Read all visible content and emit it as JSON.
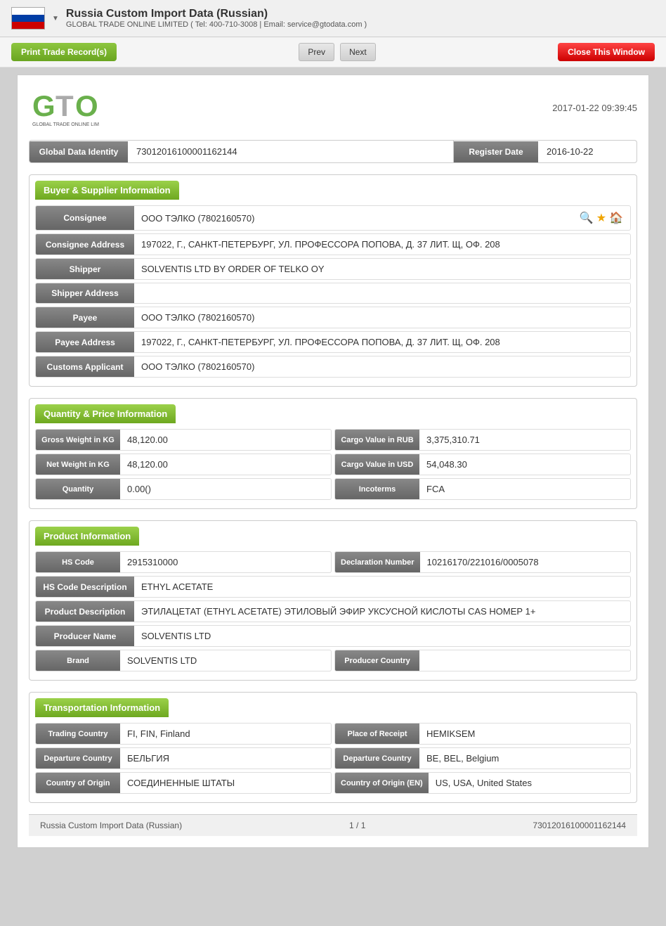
{
  "header": {
    "title": "Russia Custom Import Data (Russian)",
    "company": "GLOBAL TRADE ONLINE LIMITED ( Tel: 400-710-3008 | Email: service@gtodata.com )",
    "dropdown_arrow": "▼"
  },
  "toolbar": {
    "print_label": "Print Trade Record(s)",
    "prev_label": "Prev",
    "next_label": "Next",
    "close_label": "Close This Window"
  },
  "record": {
    "datetime": "2017-01-22 09:39:45",
    "global_data_identity_label": "Global Data Identity",
    "global_data_identity_value": "73012016100001162144",
    "register_date_label": "Register Date",
    "register_date_value": "2016-10-22"
  },
  "buyer_supplier": {
    "section_title": "Buyer & Supplier Information",
    "consignee_label": "Consignee",
    "consignee_value": "ООО ТЭЛКО (7802160570)",
    "consignee_address_label": "Consignee Address",
    "consignee_address_value": "197022, Г., САНКТ-ПЕТЕРБУРГ, УЛ. ПРОФЕССОРА ПОПОВА, Д. 37 ЛИТ. Щ, ОФ. 208",
    "shipper_label": "Shipper",
    "shipper_value": "SOLVENTIS LTD BY ORDER OF TELKO OY",
    "shipper_address_label": "Shipper Address",
    "shipper_address_value": "",
    "payee_label": "Payee",
    "payee_value": "ООО ТЭЛКО (7802160570)",
    "payee_address_label": "Payee Address",
    "payee_address_value": "197022, Г., САНКТ-ПЕТЕРБУРГ, УЛ. ПРОФЕССОРА ПОПОВА, Д. 37 ЛИТ. Щ, ОФ. 208",
    "customs_applicant_label": "Customs Applicant",
    "customs_applicant_value": "ООО ТЭЛКО (7802160570)"
  },
  "quantity_price": {
    "section_title": "Quantity & Price Information",
    "gross_weight_label": "Gross Weight in KG",
    "gross_weight_value": "48,120.00",
    "cargo_value_rub_label": "Cargo Value in RUB",
    "cargo_value_rub_value": "3,375,310.71",
    "net_weight_label": "Net Weight in KG",
    "net_weight_value": "48,120.00",
    "cargo_value_usd_label": "Cargo Value in USD",
    "cargo_value_usd_value": "54,048.30",
    "quantity_label": "Quantity",
    "quantity_value": "0.00()",
    "incoterms_label": "Incoterms",
    "incoterms_value": "FCA"
  },
  "product": {
    "section_title": "Product Information",
    "hs_code_label": "HS Code",
    "hs_code_value": "2915310000",
    "declaration_number_label": "Declaration Number",
    "declaration_number_value": "10216170/221016/0005078",
    "hs_code_desc_label": "HS Code Description",
    "hs_code_desc_value": "ETHYL ACETATE",
    "product_desc_label": "Product Description",
    "product_desc_value": "ЭТИЛАЦЕТАТ (ETHYL ACETATE) ЭТИЛОВЫЙ ЭФИР УКСУСНОЙ КИСЛОТЫ CAS НОМЕР 1+",
    "producer_name_label": "Producer Name",
    "producer_name_value": "SOLVENTIS LTD",
    "brand_label": "Brand",
    "brand_value": "SOLVENTIS LTD",
    "producer_country_label": "Producer Country",
    "producer_country_value": ""
  },
  "transportation": {
    "section_title": "Transportation Information",
    "trading_country_label": "Trading Country",
    "trading_country_value": "FI, FIN, Finland",
    "place_of_receipt_label": "Place of Receipt",
    "place_of_receipt_value": "HEMIKSEM",
    "departure_country_label": "Departure Country",
    "departure_country_value": "БЕЛЬГИЯ",
    "departure_country_en_label": "Departure Country",
    "departure_country_en_value": "BE, BEL, Belgium",
    "country_of_origin_label": "Country of Origin",
    "country_of_origin_value": "СОЕДИНЕННЫЕ ШТАТЫ",
    "country_of_origin_en_label": "Country of Origin (EN)",
    "country_of_origin_en_value": "US, USA, United States"
  },
  "footer": {
    "left": "Russia Custom Import Data (Russian)",
    "center": "1 / 1",
    "right": "73012016100001162144"
  }
}
